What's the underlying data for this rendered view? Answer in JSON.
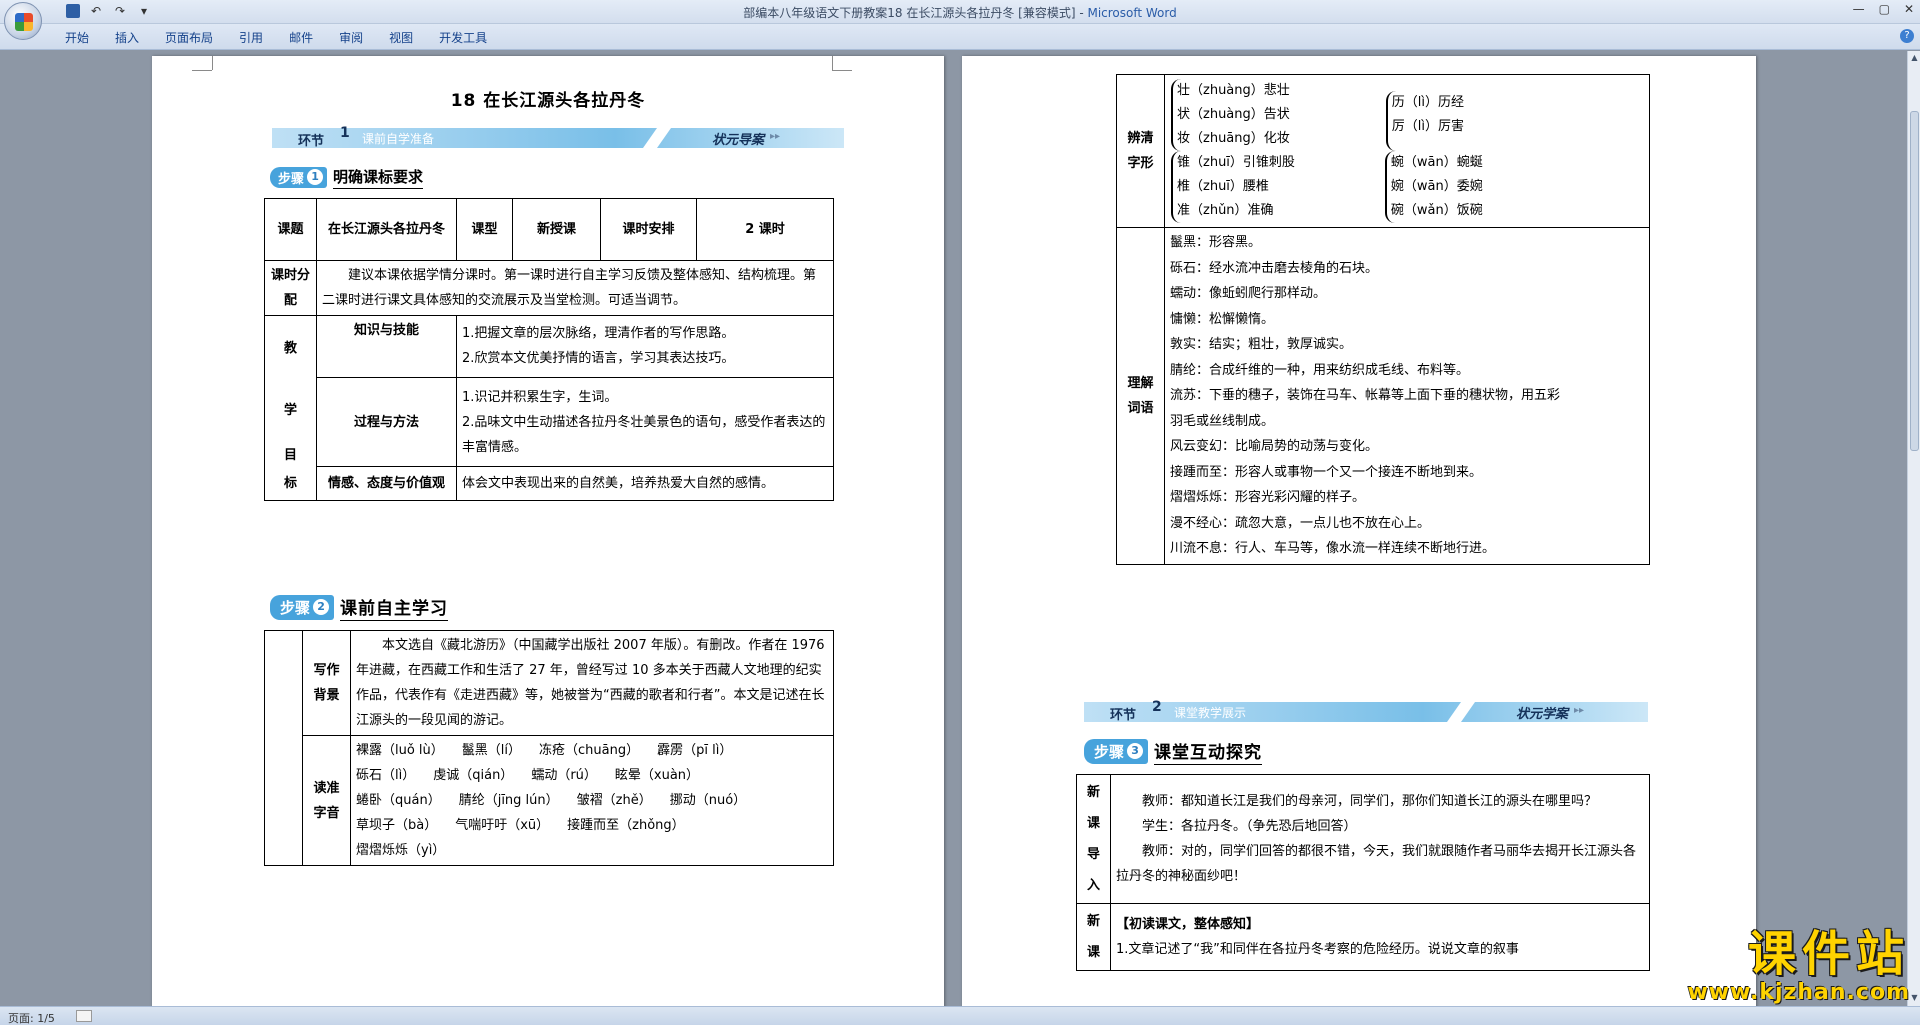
{
  "window": {
    "title": "部编本八年级语文下册教案18 在长江源头各拉丹冬 [兼容模式] - ",
    "app_name": "Microsoft Word",
    "controls": [
      "—",
      "▢",
      "✕"
    ]
  },
  "quick_access": {
    "save_icon": "save-icon",
    "undo": "↶",
    "redo": "↷",
    "customize": "▾"
  },
  "ribbon": {
    "tabs": [
      "开始",
      "插入",
      "页面布局",
      "引用",
      "邮件",
      "审阅",
      "视图",
      "开发工具"
    ],
    "help": "?"
  },
  "statusbar": {
    "page_info": "页面: 1/5"
  },
  "left_page": {
    "title": "18  在长江源头各拉丹冬",
    "banner1": {
      "label": "环节",
      "num": "1",
      "sub": "课前自学准备",
      "right_a": "状元",
      "right_b": "导案",
      "arrows": "▸▸"
    },
    "step1": {
      "label": "步骤",
      "num": "1",
      "text": "明确课标要求"
    },
    "table1": {
      "r1": [
        "课题",
        "在长江源头各拉丹冬",
        "课型",
        "新授课",
        "课时安排",
        "2 课时"
      ],
      "alloc_label": "课时分配",
      "alloc_text": "建议本课依据学情分课时。第一课时进行自主学习反馈及整体感知、结构梳理。第二课时进行课文具体感知的交流展示及当堂检测。可适当调节。",
      "goal_label": [
        "教",
        "学",
        "目",
        "标"
      ],
      "k_label": "知识与技能",
      "k_items": [
        "1.把握文章的层次脉络，理清作者的写作思路。",
        "2.欣赏本文优美抒情的语言，学习其表达技巧。"
      ],
      "p_label": "过程与方法",
      "p_items": [
        "1.识记并积累生字，生词。",
        "2.品味文中生动描述各拉丹冬壮美景色的语句，感受作者表达的丰富情感。"
      ],
      "e_label": "情感、态度与价值观",
      "e_text": "体会文中表现出来的自然美，培养热爱大自然的感情。"
    },
    "step2": {
      "label": "步骤",
      "num": "2",
      "text": "课前自主学习"
    },
    "table2": {
      "bg_label": "写作背景",
      "bg_text": "本文选自《藏北游历》（中国藏学出版社 2007 年版）。有删改。作者在 1976 年进藏，在西藏工作和生活了 27 年，曾经写过 10 多本关于西藏人文地理的纪实作品，代表作有《走进西藏》等，她被誉为“西藏的歌者和行者”。本文是记述在长江源头的一段见闻的游记。",
      "read_label": "读准字音",
      "pinyin_rows": [
        [
          "裸露（luǒ lù）",
          "鬣黑（lí）",
          "冻疮（chuāng）",
          "霹雳（pī lì）"
        ],
        [
          "砾石（lì）",
          "虔诚（qián）",
          "蠕动（rú）",
          "眩晕（xuàn）"
        ],
        [
          "蜷卧（quán）",
          "腈纶（jīng lún）",
          "皱褶（zhě）",
          "挪动（nuó）"
        ],
        [
          "草坝子（bà）",
          "气喘吁吁（xū）",
          "接踵而至（zhǒng）"
        ],
        [
          "熠熠烁烁（yì）"
        ]
      ]
    }
  },
  "right_page": {
    "distinguish_label": "辨清字形",
    "group1_left": [
      "壮（zhuàng）悲壮",
      "状（zhuàng）告状",
      "妆（zhuāng）化妆"
    ],
    "group1_right": [
      "历（lì）历经",
      "厉（lì）厉害"
    ],
    "group2_left": [
      "锥（zhuī）引锥刺股",
      "椎（zhuī）腰椎",
      "准（zhǔn）准确"
    ],
    "group2_right": [
      "蜿（wān）蜿蜒",
      "婉（wān）委婉",
      "碗（wǎn）饭碗"
    ],
    "words_label": "理解词语",
    "words": [
      "鬣黑：形容黑。",
      "砾石：经水流冲击磨去棱角的石块。",
      "蠕动：像蚯蚓爬行那样动。",
      "慵懒：松懈懒惰。",
      "敦实：结实；粗壮，敦厚诚实。",
      "腈纶：合成纤维的一种，用来纺织成毛线、布料等。",
      "流苏：下垂的穗子，装饰在马车、帐幕等上面下垂的穗状物，用五彩",
      "羽毛或丝线制成。",
      "风云变幻：比喻局势的动荡与变化。",
      "接踵而至：形容人或事物一个又一个接连不断地到来。",
      "熠熠烁烁：形容光彩闪耀的样子。",
      "漫不经心：疏忽大意，一点儿也不放在心上。",
      "川流不息：行人、车马等，像水流一样连续不断地行进。"
    ],
    "banner2": {
      "label": "环节",
      "num": "2",
      "sub": "课堂教学展示",
      "right_a": "状元",
      "right_b": "学案",
      "arrows": "▸▸"
    },
    "step3": {
      "label": "步骤",
      "num": "3",
      "text": "课堂互动探究"
    },
    "intro_label": "新课导入",
    "intro_lines": [
      "教师：都知道长江是我们的母亲河，同学们，那你们知道长江的源头在哪里吗？",
      "学生：各拉丹冬。（争先恐后地回答）",
      "教师：对的，同学们回答的都很不错，今天，我们就跟随作者马丽华去揭开长江源头各拉丹冬的神秘面纱吧！"
    ],
    "new_label": "新课",
    "new_heading": "【初读课文，整体感知】",
    "new_q1": "1.文章记述了“我”和同伴在各拉丹冬考察的危险经历。说说文章的叙事"
  },
  "watermark": {
    "text": "课件站",
    "url": "www.kjzhan.com"
  }
}
